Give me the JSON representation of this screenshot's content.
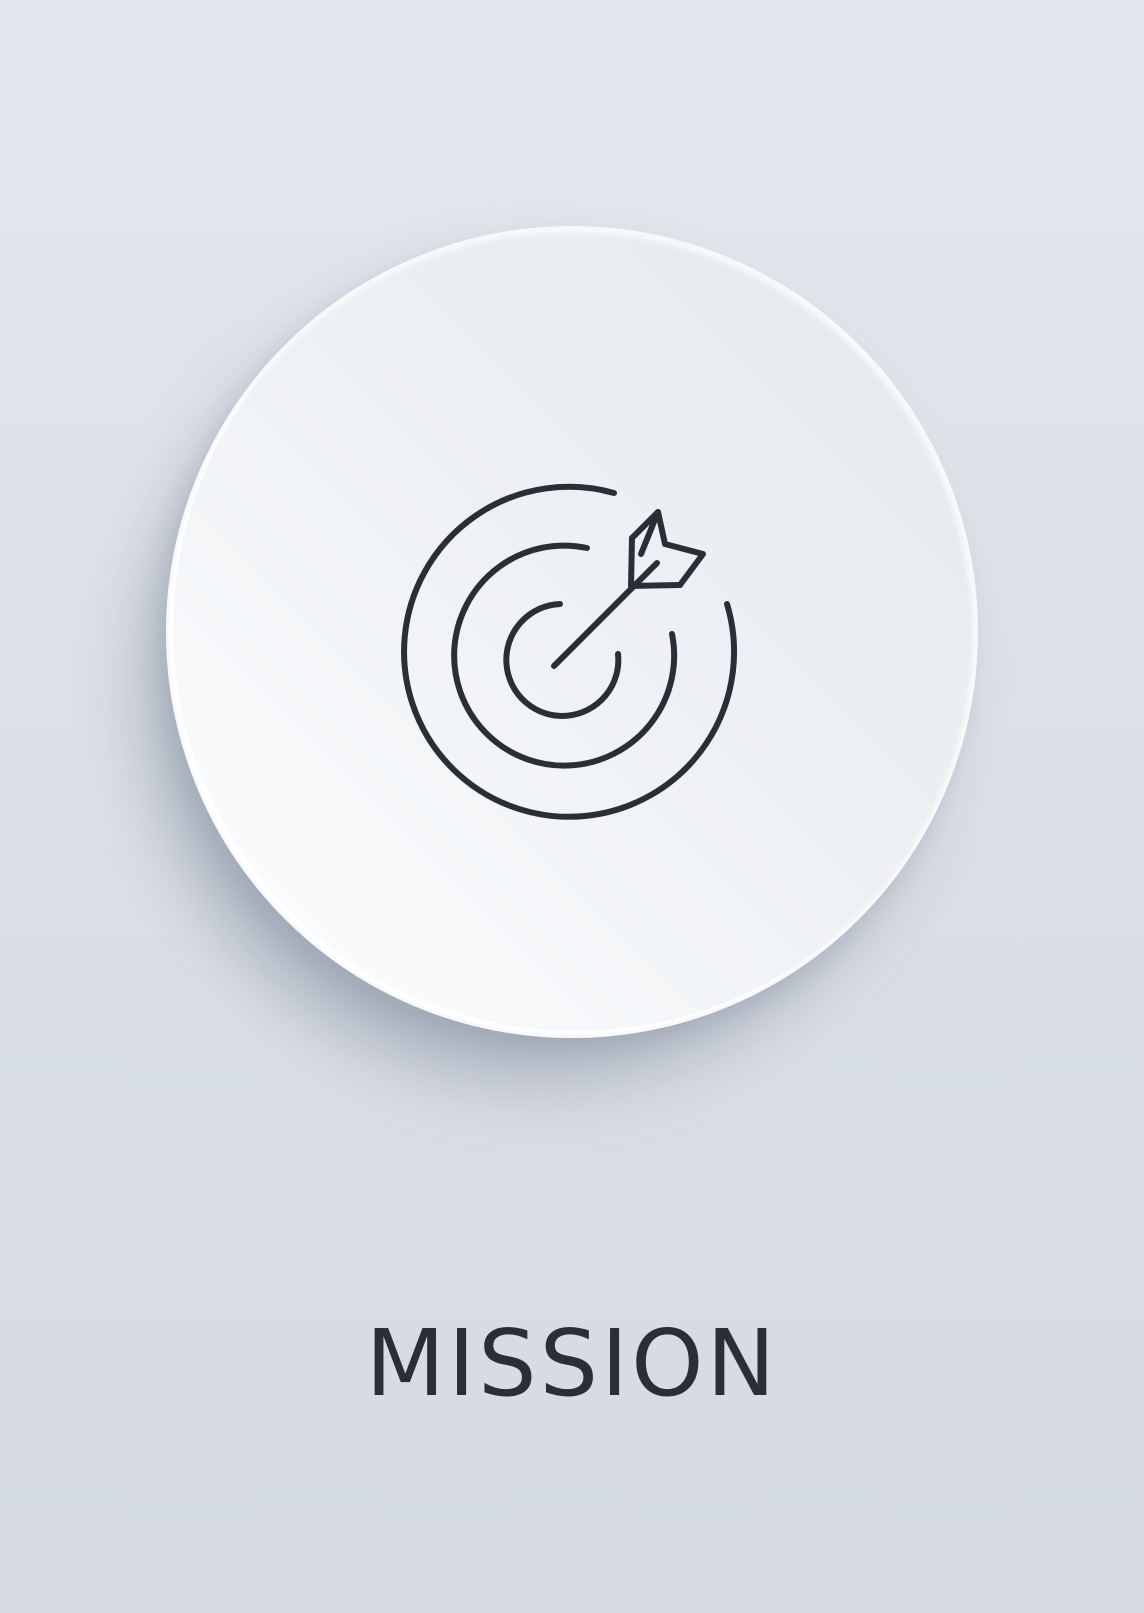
{
  "card": {
    "label": "MISSION",
    "icon": "target-arrow-icon"
  },
  "colors": {
    "background": "#dde1e8",
    "disc": "#f2f4f7",
    "icon_stroke": "#2b2f35",
    "label": "#2b2f35"
  }
}
